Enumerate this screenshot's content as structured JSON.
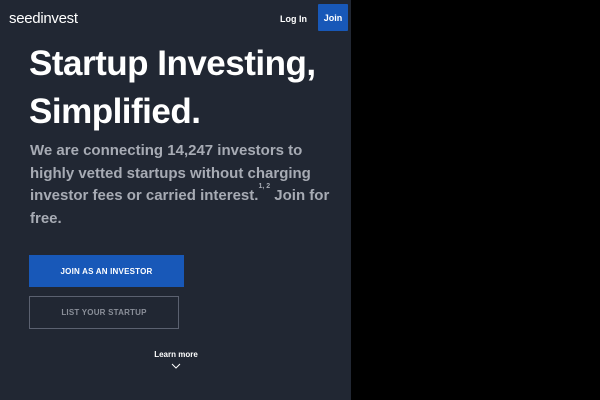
{
  "header": {
    "logo_text": "seedinvest",
    "login_label": "Log In",
    "join_label": "Join"
  },
  "hero": {
    "headline_line1": "Startup Investing,",
    "headline_line2": "Simplified.",
    "sub_part1": "We are connecting 14,247 investors to highly vetted startups without charging investor fees or carried interest.",
    "sub_footnotes": "1, 2",
    "sub_part2": " Join for free."
  },
  "buttons": {
    "join_investor_label": "JOIN AS AN INVESTOR",
    "list_startup_label": "LIST YOUR STARTUP"
  },
  "learn_more": {
    "label": "Learn more",
    "icon": "chevron-down-icon"
  },
  "colors": {
    "background": "#212733",
    "accent": "#1858b8",
    "subtext": "#a7abb4",
    "outline": "#5b6170"
  }
}
